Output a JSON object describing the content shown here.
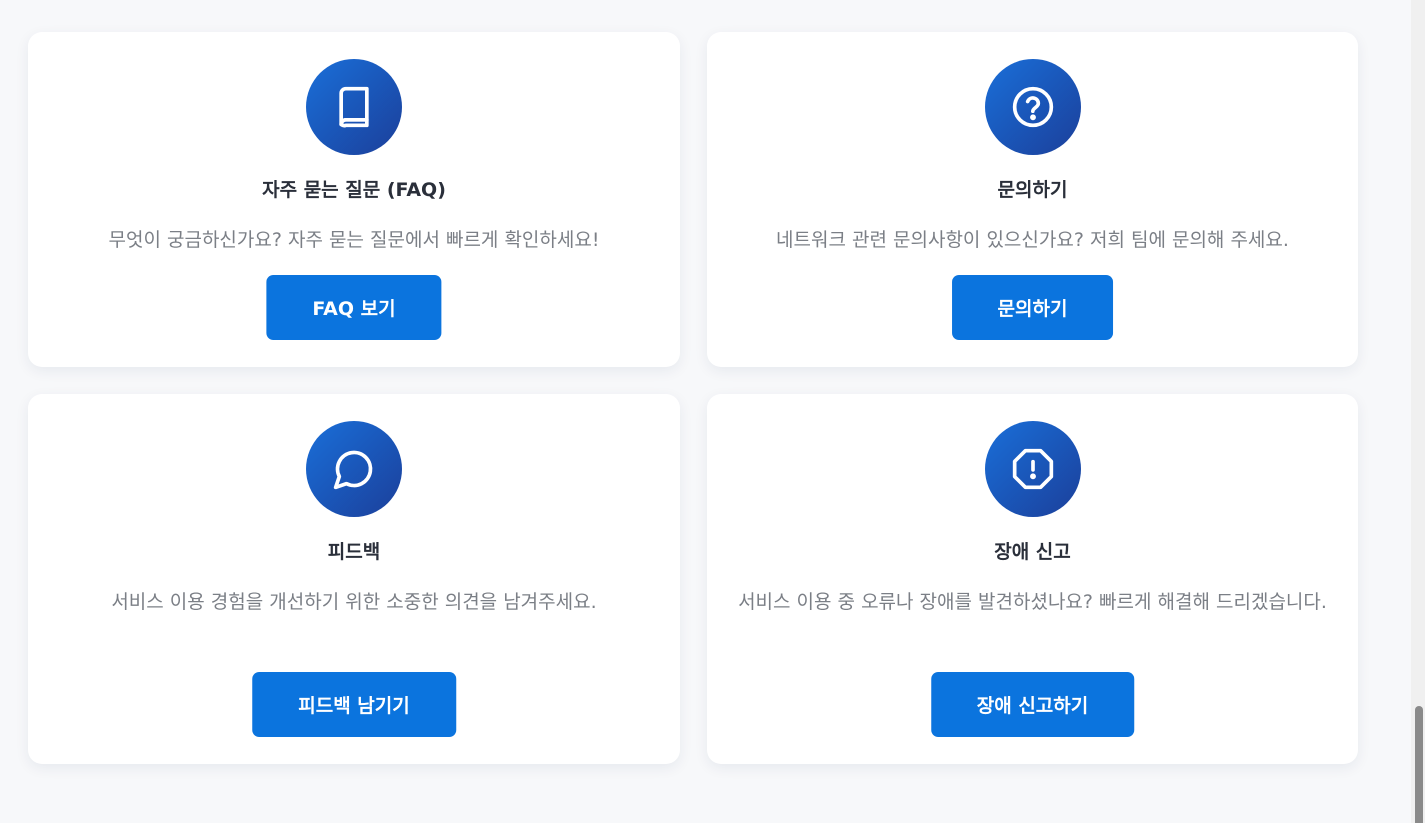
{
  "cards": [
    {
      "icon": "book-icon",
      "title": "자주 묻는 질문 (FAQ)",
      "description": "무엇이 궁금하신가요? 자주 묻는 질문에서 빠르게 확인하세요!",
      "button_label": "FAQ 보기"
    },
    {
      "icon": "question-circle-icon",
      "title": "문의하기",
      "description": "네트워크 관련 문의사항이 있으신가요? 저희 팀에 문의해 주세요.",
      "button_label": "문의하기"
    },
    {
      "icon": "chat-bubble-icon",
      "title": "피드백",
      "description": "서비스 이용 경험을 개선하기 위한 소중한 의견을 남겨주세요.",
      "button_label": "피드백 남기기"
    },
    {
      "icon": "alert-octagon-icon",
      "title": "장애 신고",
      "description": "서비스 이용 중 오류나 장애를 발견하셨나요? 빠르게 해결해 드리겠습니다.",
      "button_label": "장애 신고하기"
    }
  ],
  "colors": {
    "accent": "#0b74de",
    "icon_gradient_start": "#1a6fd9",
    "icon_gradient_end": "#1b3f9a",
    "page_background": "#f7f8fa"
  }
}
